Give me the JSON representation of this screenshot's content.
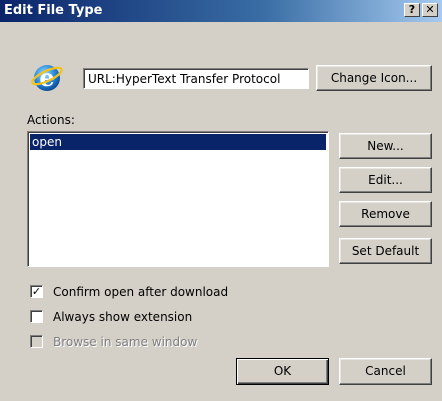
{
  "window": {
    "title": "Edit File Type",
    "help_glyph": "?",
    "close_glyph": "✕"
  },
  "file_type": {
    "icon": "internet-explorer-icon",
    "description": "URL:HyperText Transfer Protocol",
    "change_icon_label": "Change Icon..."
  },
  "actions": {
    "label": "Actions:",
    "items": [
      "open"
    ],
    "selected": "open",
    "buttons": {
      "new": "New...",
      "edit": "Edit...",
      "remove": "Remove",
      "set_default": "Set Default"
    }
  },
  "options": {
    "confirm_open": {
      "label": "Confirm open after download",
      "checked": true,
      "mark": "✓"
    },
    "always_show_ext": {
      "label": "Always show extension",
      "checked": false
    },
    "browse_same_window": {
      "label": "Browse in same window",
      "checked": false,
      "disabled": true
    }
  },
  "footer": {
    "ok": "OK",
    "cancel": "Cancel"
  },
  "colors": {
    "selection": "#0a246a",
    "face": "#d4d0c8"
  }
}
